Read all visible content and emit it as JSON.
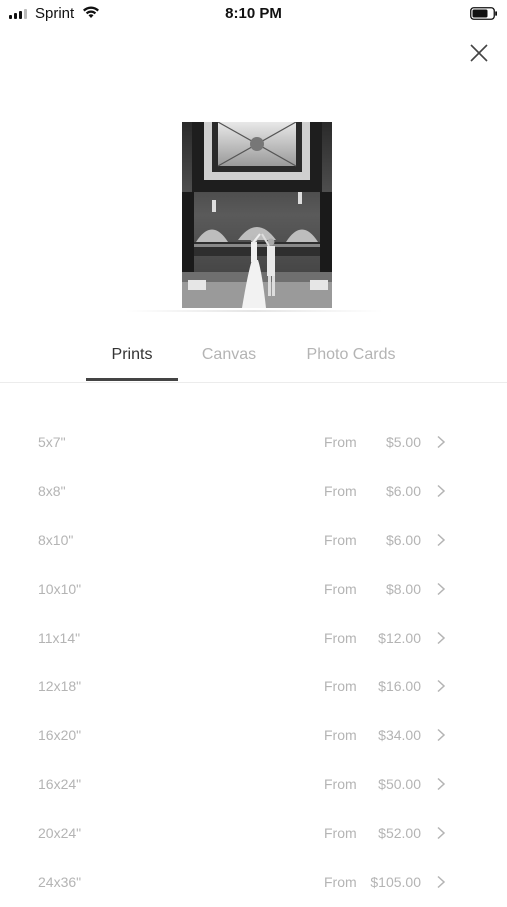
{
  "status_bar": {
    "carrier": "Sprint",
    "time": "8:10 PM",
    "signal_bars_active": 3
  },
  "close_button": {
    "icon": "close-icon"
  },
  "preview": {
    "description_icon": "photo-preview"
  },
  "tabs": [
    {
      "label": "Prints",
      "active": true
    },
    {
      "label": "Canvas",
      "active": false
    },
    {
      "label": "Photo Cards",
      "active": false
    }
  ],
  "sizes": [
    {
      "size": "5x7\"",
      "from": "From",
      "price": "$5.00"
    },
    {
      "size": "8x8\"",
      "from": "From",
      "price": "$6.00"
    },
    {
      "size": "8x10\"",
      "from": "From",
      "price": "$6.00"
    },
    {
      "size": "10x10\"",
      "from": "From",
      "price": "$8.00"
    },
    {
      "size": "11x14\"",
      "from": "From",
      "price": "$12.00"
    },
    {
      "size": "12x18\"",
      "from": "From",
      "price": "$16.00"
    },
    {
      "size": "16x20\"",
      "from": "From",
      "price": "$34.00"
    },
    {
      "size": "16x24\"",
      "from": "From",
      "price": "$50.00"
    },
    {
      "size": "20x24\"",
      "from": "From",
      "price": "$52.00"
    },
    {
      "size": "24x36\"",
      "from": "From",
      "price": "$105.00"
    }
  ],
  "colors": {
    "text_active": "#333333",
    "text_muted": "#b4b4b4",
    "underline": "#444444"
  }
}
